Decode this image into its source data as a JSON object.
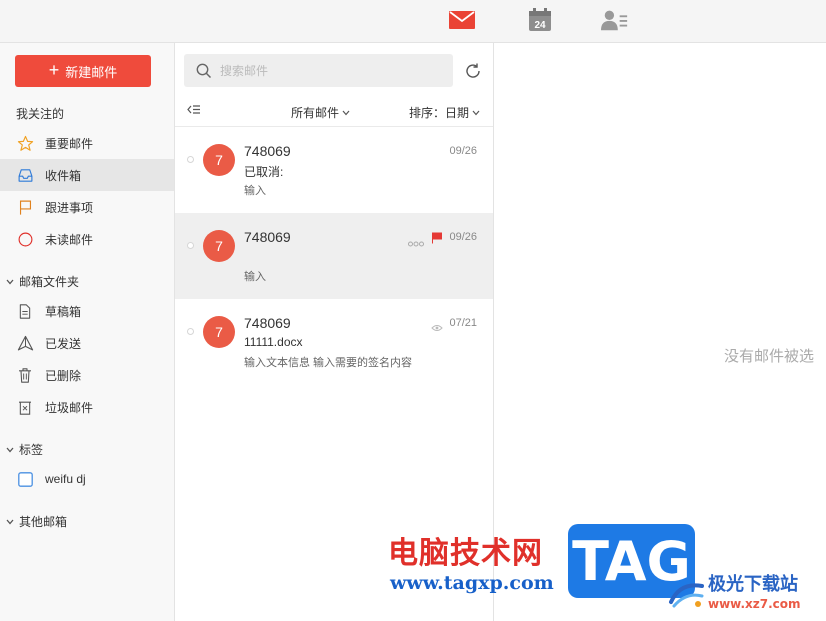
{
  "topbar": {
    "icons": [
      "mail-icon",
      "calendar-icon",
      "contacts-icon"
    ],
    "calendar_day": "24"
  },
  "sidebar": {
    "new_mail_label": "新建邮件",
    "favorites_title": "我关注的",
    "favorites": [
      {
        "label": "重要邮件",
        "icon": "star-icon"
      },
      {
        "label": "收件箱",
        "icon": "inbox-icon",
        "active": true
      },
      {
        "label": "跟进事项",
        "icon": "flag-icon"
      },
      {
        "label": "未读邮件",
        "icon": "circle-icon"
      }
    ],
    "folders_title": "邮箱文件夹",
    "folders": [
      {
        "label": "草稿箱",
        "icon": "draft-icon"
      },
      {
        "label": "已发送",
        "icon": "send-icon"
      },
      {
        "label": "已删除",
        "icon": "trash-icon"
      },
      {
        "label": "垃圾邮件",
        "icon": "spam-icon"
      }
    ],
    "tags_title": "标签",
    "tags": [
      {
        "label": "weifu dj",
        "icon": "checkbox-icon"
      }
    ],
    "other_title": "其他邮箱"
  },
  "list": {
    "search_placeholder": "搜索邮件",
    "filter_label": "所有邮件",
    "sort_label": "排序：日期",
    "mails": [
      {
        "avatar": "7",
        "sender": "748069",
        "subject": "已取消:",
        "preview": "输入",
        "date": "09/26",
        "flagged": false,
        "selected": false
      },
      {
        "avatar": "7",
        "sender": "748069",
        "subject": "",
        "preview": "输入",
        "date": "09/26",
        "flagged": true,
        "selected": true
      },
      {
        "avatar": "7",
        "sender": "748069",
        "subject": "11111.docx",
        "preview": "输入文本信息 输入需要的签名内容",
        "date": "07/21",
        "flagged": false,
        "selected": false
      }
    ]
  },
  "reader": {
    "empty_text": "没有邮件被选"
  },
  "watermark": {
    "site_cn": "电脑技术网",
    "site_url": "www.tagxp.com",
    "logo_text": "TAG",
    "brand2_cn": "极光下载站",
    "brand2_url": "www.xz7.com"
  },
  "colors": {
    "accent": "#ef4b3c",
    "avatar": "#ea5b46",
    "flag": "#e53935"
  }
}
